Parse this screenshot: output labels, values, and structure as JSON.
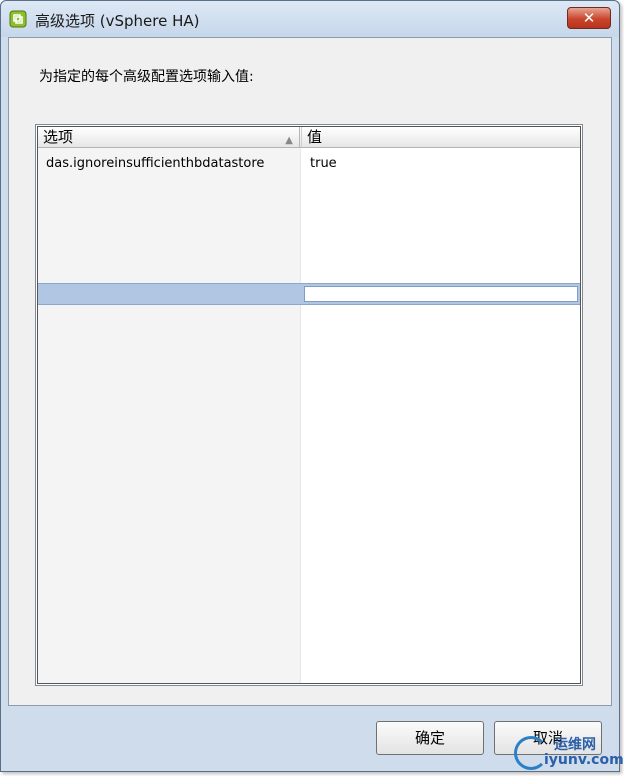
{
  "window": {
    "title": "高级选项 (vSphere HA)",
    "close_symbol": "✕",
    "icon": "vsphere-app-icon"
  },
  "prompt": "为指定的每个高级配置选项输入值:",
  "table": {
    "columns": [
      "选项",
      "值"
    ],
    "sort_indicator": "▲",
    "rows": [
      {
        "option": "das.ignoreinsufficienthbdatastore",
        "value": "true"
      }
    ],
    "new_row": {
      "option": "",
      "value": ""
    }
  },
  "buttons": {
    "ok": "确定",
    "cancel": "取消"
  },
  "watermark": {
    "cn": "运维网",
    "url": "iyunv.com"
  },
  "colors": {
    "accent_selection": "#b0c6e3",
    "close_button": "#c9452c"
  }
}
